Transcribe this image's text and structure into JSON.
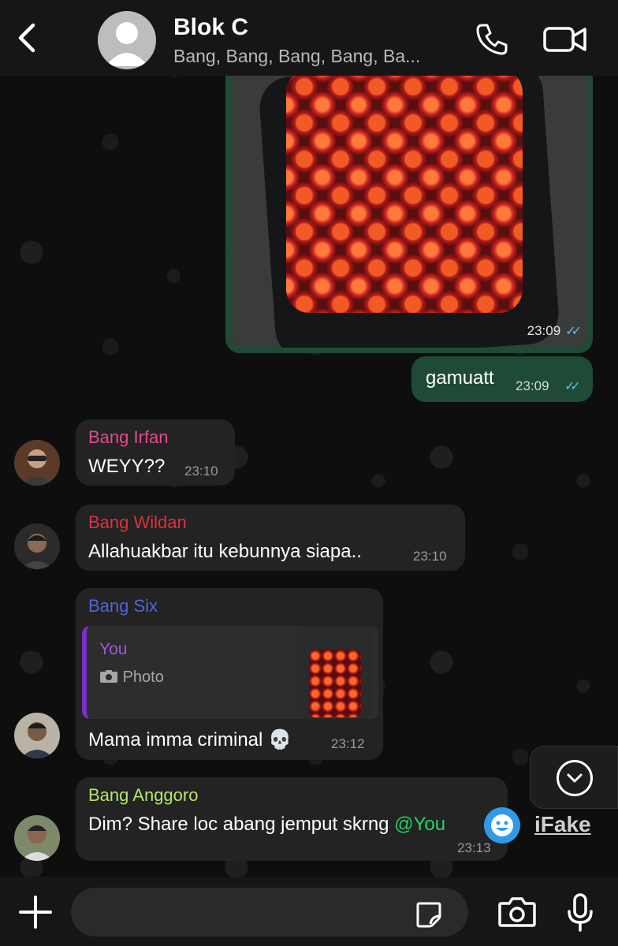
{
  "header": {
    "title": "Blok C",
    "subtitle": "Bang, Bang, Bang, Bang, Ba..."
  },
  "messages": {
    "image_out": {
      "time": "23:09",
      "status": "read"
    },
    "text_out": {
      "text": "gamuatt",
      "time": "23:09",
      "status": "read"
    },
    "irfan": {
      "sender": "Bang Irfan",
      "sender_color": "#e34a8f",
      "text": "WEYY??",
      "time": "23:10"
    },
    "wildan": {
      "sender": "Bang Wildan",
      "sender_color": "#e0303e",
      "text": "Allahuakbar itu kebunnya siapa..",
      "time": "23:10"
    },
    "six": {
      "sender": "Bang Six",
      "sender_color": "#5165d8",
      "quote_sender": "You",
      "quote_type_icon": "camera-icon",
      "quote_type": "Photo",
      "text": "Mama imma criminal 💀",
      "time": "23:12"
    },
    "anggoro": {
      "sender": "Bang Anggoro",
      "sender_color": "#b6e468",
      "text": "Dim? Share loc abang jemput skrng ",
      "mention": "@You",
      "mention_color": "#25d366",
      "time": "23:13"
    }
  },
  "watermark": {
    "text": "iFake"
  },
  "colors": {
    "outgoing_bubble": "#1f4a36",
    "incoming_bubble": "#232323",
    "read_ticks": "#6ab7f0"
  }
}
